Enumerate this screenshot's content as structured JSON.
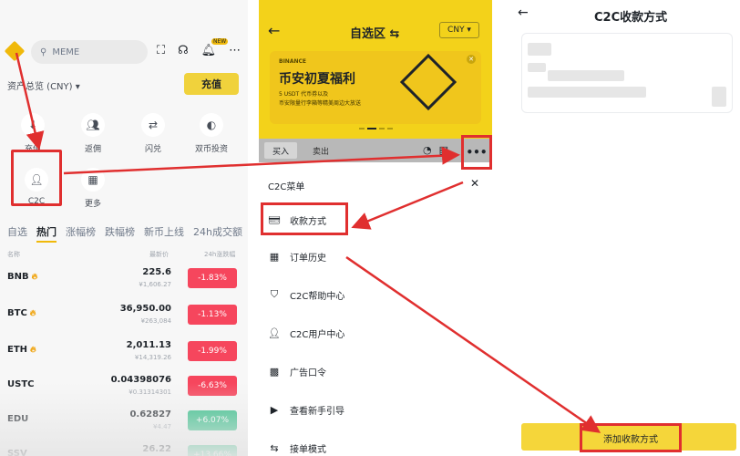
{
  "panel1": {
    "search_placeholder": "MEME",
    "new_badge": "NEW",
    "assets_label": "资产总览 (CNY) ▾",
    "recharge_label": "充值",
    "quick_actions": [
      "充值",
      "返佣",
      "闪兑",
      "双币投资",
      "C2C",
      "更多"
    ],
    "market_tabs": [
      "自选",
      "热门",
      "涨幅榜",
      "跌幅榜",
      "新币上线",
      "24h成交额",
      "市"
    ],
    "col_name": "名称",
    "col_price": "最新价",
    "col_change": "24h涨跌幅",
    "rows": [
      {
        "symbol": "BNB",
        "price": "225.6",
        "sub": "¥1,606.27",
        "change": "-1.83%"
      },
      {
        "symbol": "BTC",
        "price": "36,950.00",
        "sub": "¥263,084",
        "change": "-1.13%"
      },
      {
        "symbol": "ETH",
        "price": "2,011.13",
        "sub": "¥14,319.26",
        "change": "-1.99%"
      },
      {
        "symbol": "USTC",
        "price": "0.04398076",
        "sub": "¥0.31314301",
        "change": "-6.63%"
      },
      {
        "symbol": "EDU",
        "price": "0.62827",
        "sub": "¥4.47",
        "change": "+6.07%"
      },
      {
        "symbol": "SSV",
        "price": "26.22",
        "sub": "",
        "change": "+13.66%"
      }
    ]
  },
  "panel2": {
    "back": "←",
    "title": "自选区 ⇆",
    "currency": "CNY ▾",
    "banner": {
      "brand": "BINANCE",
      "title": "币安初夏福利",
      "line1": "5 USDT 代币券以及",
      "line2": "币安限量行李箱等精美周边大放送"
    },
    "buy": "买入",
    "sell": "卖出",
    "more": "•••",
    "sheet_title": "C2C菜单",
    "close": "✕",
    "menu": [
      "收款方式",
      "订单历史",
      "C2C帮助中心",
      "C2C用户中心",
      "广告口令",
      "查看新手引导",
      "接单模式"
    ]
  },
  "panel3": {
    "back": "←",
    "title": "C2C收款方式",
    "add_button": "添加收款方式"
  },
  "colors": {
    "accent_yellow": "#f0b90b",
    "highlight_red": "#e02f2f",
    "down_red": "#f6465d",
    "up_green": "#2ebd85"
  }
}
